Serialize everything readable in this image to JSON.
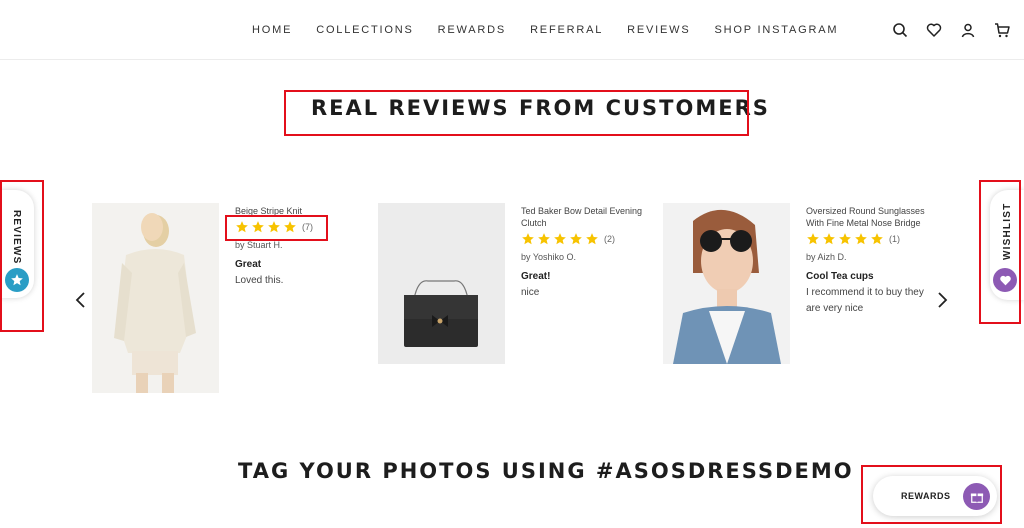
{
  "nav": {
    "items": [
      "HOME",
      "COLLECTIONS",
      "REWARDS",
      "REFERRAL",
      "REVIEWS",
      "SHOP INSTAGRAM"
    ],
    "icons": [
      "search-icon",
      "heart-icon",
      "user-icon",
      "cart-icon"
    ]
  },
  "reviews_section": {
    "title": "REAL REVIEWS FROM CUSTOMERS",
    "cards": [
      {
        "product": "Beige Stripe Knit",
        "rating": 4,
        "count": "(7)",
        "author": "by Stuart H.",
        "title": "Great",
        "body": "Loved this."
      },
      {
        "product": "Ted Baker Bow Detail Evening Clutch",
        "rating": 5,
        "count": "(2)",
        "author": "by Yoshiko O.",
        "title": "Great!",
        "body": "nice"
      },
      {
        "product": "Oversized Round Sunglasses With Fine Metal Nose Bridge",
        "rating": 5,
        "count": "(1)",
        "author": "by Aizh D.",
        "title": "Cool Tea cups",
        "body": "I recommend it to buy they are very nice"
      }
    ]
  },
  "instagram_section": {
    "title": "TAG YOUR PHOTOS USING #ASOSDRESSDEMO"
  },
  "side_tabs": {
    "reviews": "REVIEWS",
    "wishlist": "WISHLIST"
  },
  "rewards_button": {
    "label": "REWARDS"
  },
  "colors": {
    "accent_red": "#e30f1b",
    "star": "#f7c300",
    "reviews_tab": "#2a9dc5",
    "wishlist_tab": "#8d5ab4",
    "rewards": "#8d5ab4"
  }
}
